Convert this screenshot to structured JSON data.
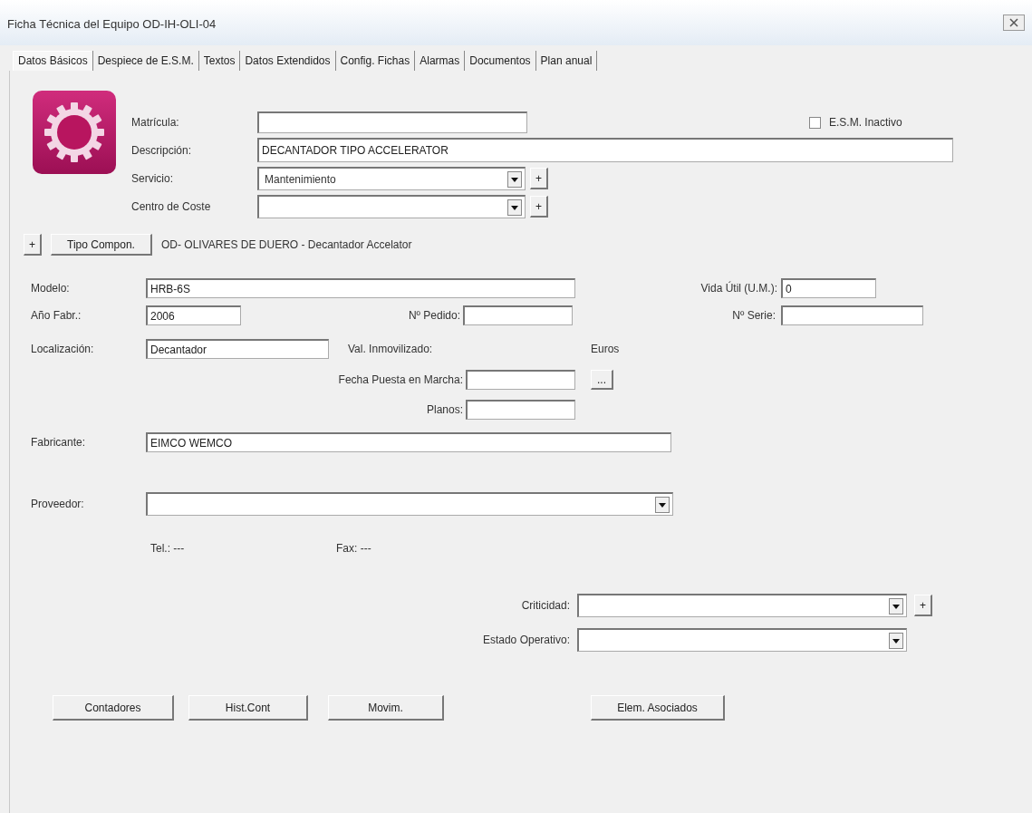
{
  "window": {
    "title": "Ficha Técnica del Equipo OD-IH-OLI-04"
  },
  "tabs": [
    {
      "label": "Datos Básicos",
      "selected": true
    },
    {
      "label": "Despiece de E.S.M.",
      "selected": false
    },
    {
      "label": "Textos",
      "selected": false
    },
    {
      "label": "Datos Extendidos",
      "selected": false
    },
    {
      "label": "Config. Fichas",
      "selected": false
    },
    {
      "label": "Alarmas",
      "selected": false
    },
    {
      "label": "Documentos",
      "selected": false
    },
    {
      "label": "Plan anual",
      "selected": false
    }
  ],
  "matricula": {
    "label": "Matrícula:"
  },
  "inactivo": {
    "label": "E.S.M. Inactivo",
    "checked": false
  },
  "descripcion": {
    "label": "Descripción:",
    "value": "DECANTADOR TIPO ACCELERATOR"
  },
  "servicio": {
    "label": "Servicio:",
    "value": "Mantenimiento",
    "add": "+"
  },
  "centro_coste": {
    "label": "Centro de Coste",
    "add": "+"
  },
  "componente": {
    "add": "+",
    "button": "Tipo Compon.",
    "text": "OD- OLIVARES DE DUERO - Decantador Accelator"
  },
  "modelo": {
    "label": "Modelo:",
    "value": "HRB-6S"
  },
  "vida_util": {
    "label": "Vida Útil (U.M.):",
    "value": "0"
  },
  "anio_fabr": {
    "label": "Año Fabr.:",
    "value": "2006"
  },
  "pedido": {
    "label": "Nº Pedido:"
  },
  "serie": {
    "label": "Nº Serie:"
  },
  "localizacion": {
    "label": "Localización:",
    "value": "Decantador"
  },
  "val_inmovilizado": {
    "label": "Val. Inmovilizado:",
    "unit": "Euros"
  },
  "fecha_marcha": {
    "label": "Fecha Puesta en Marcha:",
    "button": "..."
  },
  "planos": {
    "label": "Planos:"
  },
  "fabricante": {
    "label": "Fabricante:",
    "value": "EIMCO WEMCO"
  },
  "proveedor": {
    "label": "Proveedor:",
    "tel": "Tel.: ---",
    "fax": "Fax: ---"
  },
  "criticidad": {
    "label": "Criticidad:",
    "add": "+"
  },
  "estado_operativo": {
    "label": "Estado Operativo:"
  },
  "buttons": [
    "Contadores",
    "Hist.Cont",
    "Movim.",
    "Elem. Asociados"
  ]
}
